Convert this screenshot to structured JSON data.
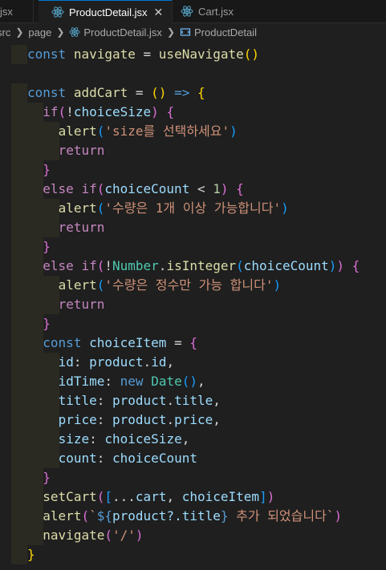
{
  "tabs": [
    {
      "label": "jsx",
      "active": false
    },
    {
      "label": "ProductDetail.jsx",
      "active": true,
      "close": "✕"
    },
    {
      "label": "Cart.jsx",
      "active": false
    }
  ],
  "breadcrumb": [
    "src",
    "page",
    "ProductDetail.jsx",
    "ProductDetail"
  ],
  "code_lines": [
    "const navigate = useNavigate()",
    "",
    "const addCart = () => {",
    "  if(!choiceSize) {",
    "    alert('size를 선택하세요')",
    "    return",
    "  }",
    "  else if(choiceCount < 1) {",
    "    alert('수량은 1개 이상 가능합니다')",
    "    return",
    "  }",
    "  else if(!Number.isInteger(choiceCount)) {",
    "    alert('수량은 정수만 가능 합니다')",
    "    return",
    "  }",
    "  const choiceItem = {",
    "    id: product.id,",
    "    idTime: new Date(),",
    "    title: product.title,",
    "    price: product.price,",
    "    size: choiceSize,",
    "    count: choiceCount",
    "  }",
    "  setCart([...cart, choiceItem])",
    "  alert(`${product?.title} 추가 되었습니다`)",
    "  navigate('/')",
    "}"
  ],
  "colors": {
    "background": "#1f1f1f",
    "keyword": "#569cd6",
    "control": "#c586c0",
    "variable": "#9cdcfe",
    "function": "#dcdcaa",
    "string": "#ce9178",
    "accent": "#0078d4"
  },
  "icons": {
    "tab_file": "react-icon",
    "close": "close-icon",
    "breadcrumb_component": "component-icon"
  }
}
